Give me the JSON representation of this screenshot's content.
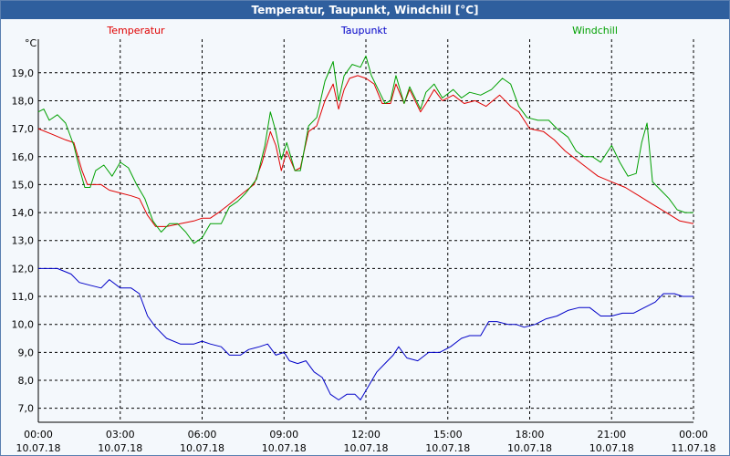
{
  "window": {
    "title": "Temperatur, Taupunkt, Windchill [°C]"
  },
  "colors": {
    "temperatur": "#e00000",
    "taupunkt": "#0000c8",
    "windchill": "#00a000",
    "grid": "#000000",
    "background": "#f4f8fc",
    "titlebar": "#2f5f9e"
  },
  "chart_data": {
    "type": "line",
    "title": "Temperatur, Taupunkt, Windchill [°C]",
    "ylabel": "°C",
    "xlabel": "",
    "grid": true,
    "legend_placement": "top",
    "ylim": [
      6.5,
      20.2
    ],
    "xlim": [
      "10.07.18 00:00",
      "11.07.18 00:00"
    ],
    "y_ticks": [
      "7,0",
      "8,0",
      "9,0",
      "10,0",
      "11,0",
      "12,0",
      "13,0",
      "14,0",
      "15,0",
      "16,0",
      "17,0",
      "18,0",
      "19,0"
    ],
    "y_tick_values": [
      7,
      8,
      9,
      10,
      11,
      12,
      13,
      14,
      15,
      16,
      17,
      18,
      19
    ],
    "x_tick_hours": [
      0,
      3,
      6,
      9,
      12,
      15,
      18,
      21,
      24
    ],
    "x_tick_times": [
      "00:00",
      "03:00",
      "06:00",
      "09:00",
      "12:00",
      "15:00",
      "18:00",
      "21:00",
      "00:00"
    ],
    "x_tick_dates": [
      "10.07.18",
      "10.07.18",
      "10.07.18",
      "10.07.18",
      "10.07.18",
      "10.07.18",
      "10.07.18",
      "10.07.18",
      "11.07.18"
    ],
    "series": [
      {
        "name": "Temperatur",
        "color": "#e00000",
        "points": [
          [
            0,
            17.0
          ],
          [
            0.5,
            16.8
          ],
          [
            1.0,
            16.6
          ],
          [
            1.3,
            16.5
          ],
          [
            1.6,
            15.5
          ],
          [
            1.8,
            15.0
          ],
          [
            2.3,
            15.0
          ],
          [
            2.6,
            14.8
          ],
          [
            3.0,
            14.7
          ],
          [
            3.4,
            14.6
          ],
          [
            3.7,
            14.5
          ],
          [
            4.0,
            13.9
          ],
          [
            4.3,
            13.5
          ],
          [
            4.7,
            13.5
          ],
          [
            5.2,
            13.6
          ],
          [
            5.7,
            13.7
          ],
          [
            6.0,
            13.8
          ],
          [
            6.3,
            13.8
          ],
          [
            6.6,
            14.0
          ],
          [
            7.0,
            14.3
          ],
          [
            7.5,
            14.7
          ],
          [
            7.9,
            15.0
          ],
          [
            8.2,
            15.8
          ],
          [
            8.5,
            16.9
          ],
          [
            8.7,
            16.4
          ],
          [
            8.9,
            15.5
          ],
          [
            9.1,
            16.2
          ],
          [
            9.4,
            15.5
          ],
          [
            9.6,
            15.6
          ],
          [
            9.9,
            16.9
          ],
          [
            10.2,
            17.1
          ],
          [
            10.5,
            18.0
          ],
          [
            10.8,
            18.6
          ],
          [
            11.0,
            17.7
          ],
          [
            11.2,
            18.4
          ],
          [
            11.4,
            18.8
          ],
          [
            11.7,
            18.9
          ],
          [
            12.0,
            18.8
          ],
          [
            12.3,
            18.6
          ],
          [
            12.6,
            17.9
          ],
          [
            12.9,
            17.9
          ],
          [
            13.1,
            18.6
          ],
          [
            13.4,
            17.9
          ],
          [
            13.6,
            18.4
          ],
          [
            14.0,
            17.6
          ],
          [
            14.2,
            17.9
          ],
          [
            14.5,
            18.4
          ],
          [
            14.8,
            18.0
          ],
          [
            15.2,
            18.2
          ],
          [
            15.6,
            17.9
          ],
          [
            16.0,
            18.0
          ],
          [
            16.4,
            17.8
          ],
          [
            16.9,
            18.2
          ],
          [
            17.3,
            17.8
          ],
          [
            17.6,
            17.6
          ],
          [
            18.0,
            17.0
          ],
          [
            18.5,
            16.9
          ],
          [
            18.9,
            16.6
          ],
          [
            19.3,
            16.2
          ],
          [
            19.7,
            15.9
          ],
          [
            20.1,
            15.6
          ],
          [
            20.5,
            15.3
          ],
          [
            21.0,
            15.1
          ],
          [
            21.5,
            14.9
          ],
          [
            22.0,
            14.6
          ],
          [
            22.5,
            14.3
          ],
          [
            23.0,
            14.0
          ],
          [
            23.5,
            13.7
          ],
          [
            24.0,
            13.6
          ]
        ]
      },
      {
        "name": "Taupunkt",
        "color": "#0000c8",
        "points": [
          [
            0,
            12.0
          ],
          [
            0.3,
            12.0
          ],
          [
            0.7,
            12.0
          ],
          [
            1.2,
            11.8
          ],
          [
            1.5,
            11.5
          ],
          [
            1.9,
            11.4
          ],
          [
            2.3,
            11.3
          ],
          [
            2.6,
            11.6
          ],
          [
            3.0,
            11.3
          ],
          [
            3.4,
            11.3
          ],
          [
            3.7,
            11.1
          ],
          [
            4.0,
            10.3
          ],
          [
            4.3,
            9.9
          ],
          [
            4.7,
            9.5
          ],
          [
            5.2,
            9.3
          ],
          [
            5.7,
            9.3
          ],
          [
            6.0,
            9.4
          ],
          [
            6.3,
            9.3
          ],
          [
            6.7,
            9.2
          ],
          [
            7.0,
            8.9
          ],
          [
            7.4,
            8.9
          ],
          [
            7.7,
            9.1
          ],
          [
            8.1,
            9.2
          ],
          [
            8.4,
            9.3
          ],
          [
            8.7,
            8.9
          ],
          [
            9.0,
            9.0
          ],
          [
            9.2,
            8.7
          ],
          [
            9.5,
            8.6
          ],
          [
            9.8,
            8.7
          ],
          [
            10.1,
            8.3
          ],
          [
            10.4,
            8.1
          ],
          [
            10.7,
            7.5
          ],
          [
            11.0,
            7.3
          ],
          [
            11.3,
            7.5
          ],
          [
            11.6,
            7.5
          ],
          [
            11.8,
            7.3
          ],
          [
            12.1,
            7.8
          ],
          [
            12.4,
            8.3
          ],
          [
            12.7,
            8.6
          ],
          [
            13.0,
            8.9
          ],
          [
            13.2,
            9.2
          ],
          [
            13.5,
            8.8
          ],
          [
            13.9,
            8.7
          ],
          [
            14.3,
            9.0
          ],
          [
            14.7,
            9.0
          ],
          [
            15.1,
            9.2
          ],
          [
            15.5,
            9.5
          ],
          [
            15.8,
            9.6
          ],
          [
            16.2,
            9.6
          ],
          [
            16.5,
            10.1
          ],
          [
            16.8,
            10.1
          ],
          [
            17.2,
            10.0
          ],
          [
            17.5,
            10.0
          ],
          [
            17.8,
            9.9
          ],
          [
            18.2,
            10.0
          ],
          [
            18.6,
            10.2
          ],
          [
            19.0,
            10.3
          ],
          [
            19.4,
            10.5
          ],
          [
            19.8,
            10.6
          ],
          [
            20.2,
            10.6
          ],
          [
            20.6,
            10.3
          ],
          [
            21.0,
            10.3
          ],
          [
            21.4,
            10.4
          ],
          [
            21.8,
            10.4
          ],
          [
            22.2,
            10.6
          ],
          [
            22.6,
            10.8
          ],
          [
            22.9,
            11.1
          ],
          [
            23.3,
            11.1
          ],
          [
            23.6,
            11.0
          ],
          [
            24.0,
            11.0
          ]
        ]
      },
      {
        "name": "Windchill",
        "color": "#00a000",
        "points": [
          [
            0,
            17.6
          ],
          [
            0.2,
            17.7
          ],
          [
            0.4,
            17.3
          ],
          [
            0.7,
            17.5
          ],
          [
            1.0,
            17.2
          ],
          [
            1.3,
            16.4
          ],
          [
            1.5,
            15.6
          ],
          [
            1.7,
            14.9
          ],
          [
            1.9,
            14.9
          ],
          [
            2.1,
            15.5
          ],
          [
            2.4,
            15.7
          ],
          [
            2.7,
            15.3
          ],
          [
            3.0,
            15.8
          ],
          [
            3.3,
            15.6
          ],
          [
            3.6,
            15.0
          ],
          [
            3.9,
            14.5
          ],
          [
            4.2,
            13.7
          ],
          [
            4.5,
            13.3
          ],
          [
            4.8,
            13.6
          ],
          [
            5.1,
            13.6
          ],
          [
            5.4,
            13.3
          ],
          [
            5.7,
            12.9
          ],
          [
            6.0,
            13.1
          ],
          [
            6.3,
            13.6
          ],
          [
            6.7,
            13.6
          ],
          [
            7.0,
            14.2
          ],
          [
            7.3,
            14.4
          ],
          [
            7.6,
            14.7
          ],
          [
            8.0,
            15.2
          ],
          [
            8.3,
            16.4
          ],
          [
            8.5,
            17.6
          ],
          [
            8.7,
            16.9
          ],
          [
            8.9,
            15.9
          ],
          [
            9.1,
            16.5
          ],
          [
            9.4,
            15.5
          ],
          [
            9.6,
            15.5
          ],
          [
            9.9,
            17.1
          ],
          [
            10.2,
            17.4
          ],
          [
            10.5,
            18.7
          ],
          [
            10.8,
            19.4
          ],
          [
            11.0,
            18.0
          ],
          [
            11.2,
            18.9
          ],
          [
            11.5,
            19.3
          ],
          [
            11.8,
            19.2
          ],
          [
            12.0,
            19.6
          ],
          [
            12.2,
            18.9
          ],
          [
            12.5,
            18.3
          ],
          [
            12.7,
            17.9
          ],
          [
            12.9,
            18.0
          ],
          [
            13.1,
            18.9
          ],
          [
            13.4,
            17.9
          ],
          [
            13.6,
            18.5
          ],
          [
            14.0,
            17.7
          ],
          [
            14.2,
            18.3
          ],
          [
            14.5,
            18.6
          ],
          [
            14.8,
            18.1
          ],
          [
            15.2,
            18.4
          ],
          [
            15.5,
            18.1
          ],
          [
            15.8,
            18.3
          ],
          [
            16.2,
            18.2
          ],
          [
            16.6,
            18.4
          ],
          [
            17.0,
            18.8
          ],
          [
            17.3,
            18.6
          ],
          [
            17.6,
            17.8
          ],
          [
            17.9,
            17.4
          ],
          [
            18.3,
            17.3
          ],
          [
            18.7,
            17.3
          ],
          [
            19.0,
            17.0
          ],
          [
            19.4,
            16.7
          ],
          [
            19.7,
            16.2
          ],
          [
            20.0,
            16.0
          ],
          [
            20.3,
            16.0
          ],
          [
            20.6,
            15.8
          ],
          [
            21.0,
            16.4
          ],
          [
            21.3,
            15.8
          ],
          [
            21.6,
            15.3
          ],
          [
            21.9,
            15.4
          ],
          [
            22.1,
            16.5
          ],
          [
            22.3,
            17.2
          ],
          [
            22.5,
            15.1
          ],
          [
            22.8,
            14.8
          ],
          [
            23.1,
            14.5
          ],
          [
            23.4,
            14.1
          ],
          [
            23.7,
            14.0
          ],
          [
            24.0,
            14.0
          ]
        ]
      }
    ]
  }
}
